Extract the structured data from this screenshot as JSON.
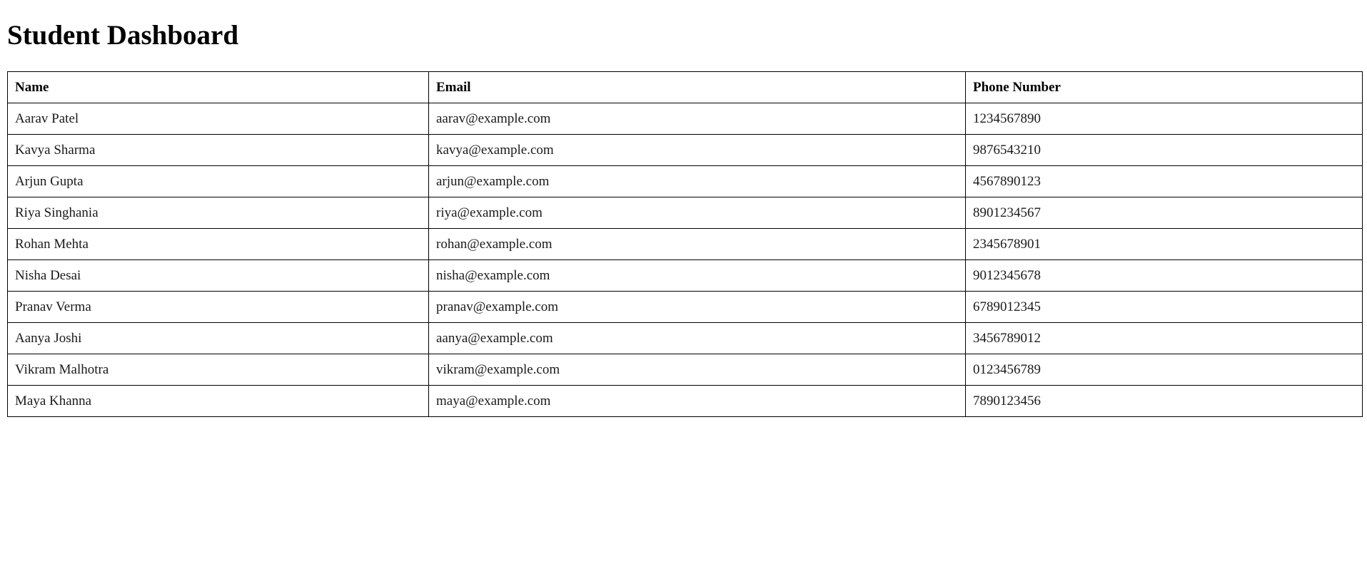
{
  "page": {
    "title": "Student Dashboard"
  },
  "table": {
    "headers": [
      "Name",
      "Email",
      "Phone Number"
    ],
    "rows": [
      [
        "Aarav Patel",
        "aarav@example.com",
        "1234567890"
      ],
      [
        "Kavya Sharma",
        "kavya@example.com",
        "9876543210"
      ],
      [
        "Arjun Gupta",
        "arjun@example.com",
        "4567890123"
      ],
      [
        "Riya Singhania",
        "riya@example.com",
        "8901234567"
      ],
      [
        "Rohan Mehta",
        "rohan@example.com",
        "2345678901"
      ],
      [
        "Nisha Desai",
        "nisha@example.com",
        "9012345678"
      ],
      [
        "Pranav Verma",
        "pranav@example.com",
        "6789012345"
      ],
      [
        "Aanya Joshi",
        "aanya@example.com",
        "3456789012"
      ],
      [
        "Vikram Malhotra",
        "vikram@example.com",
        "0123456789"
      ],
      [
        "Maya Khanna",
        "maya@example.com",
        "7890123456"
      ]
    ]
  }
}
